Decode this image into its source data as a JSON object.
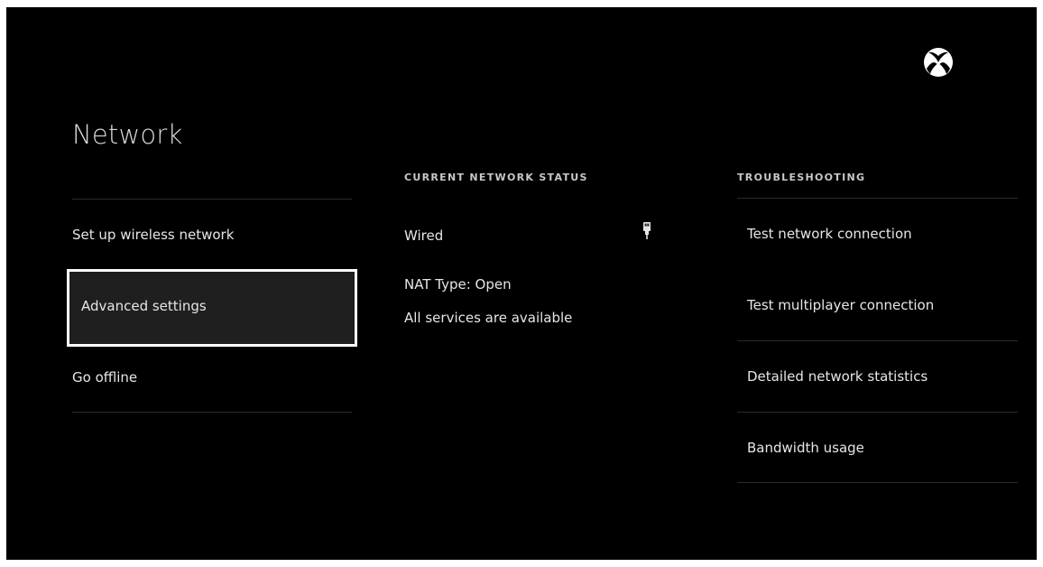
{
  "brand": {
    "logo_icon": "xbox-logo-icon",
    "accent": "#ffffff",
    "background": "#000000"
  },
  "page": {
    "title": "Network"
  },
  "menu": {
    "items": [
      {
        "label": "Set up wireless network"
      },
      {
        "label": "Advanced settings",
        "focused": true
      },
      {
        "label": "Go offline"
      }
    ]
  },
  "status": {
    "header": "CURRENT NETWORK STATUS",
    "connection": "Wired",
    "connection_icon": "ethernet-plug-icon",
    "nat_type": "NAT Type: Open",
    "services": "All services are available"
  },
  "troubleshooting": {
    "header": "TROUBLESHOOTING",
    "items": [
      {
        "label": "Test network connection"
      },
      {
        "label": "Test multiplayer connection"
      },
      {
        "label": "Detailed network statistics"
      },
      {
        "label": "Bandwidth usage"
      }
    ]
  }
}
